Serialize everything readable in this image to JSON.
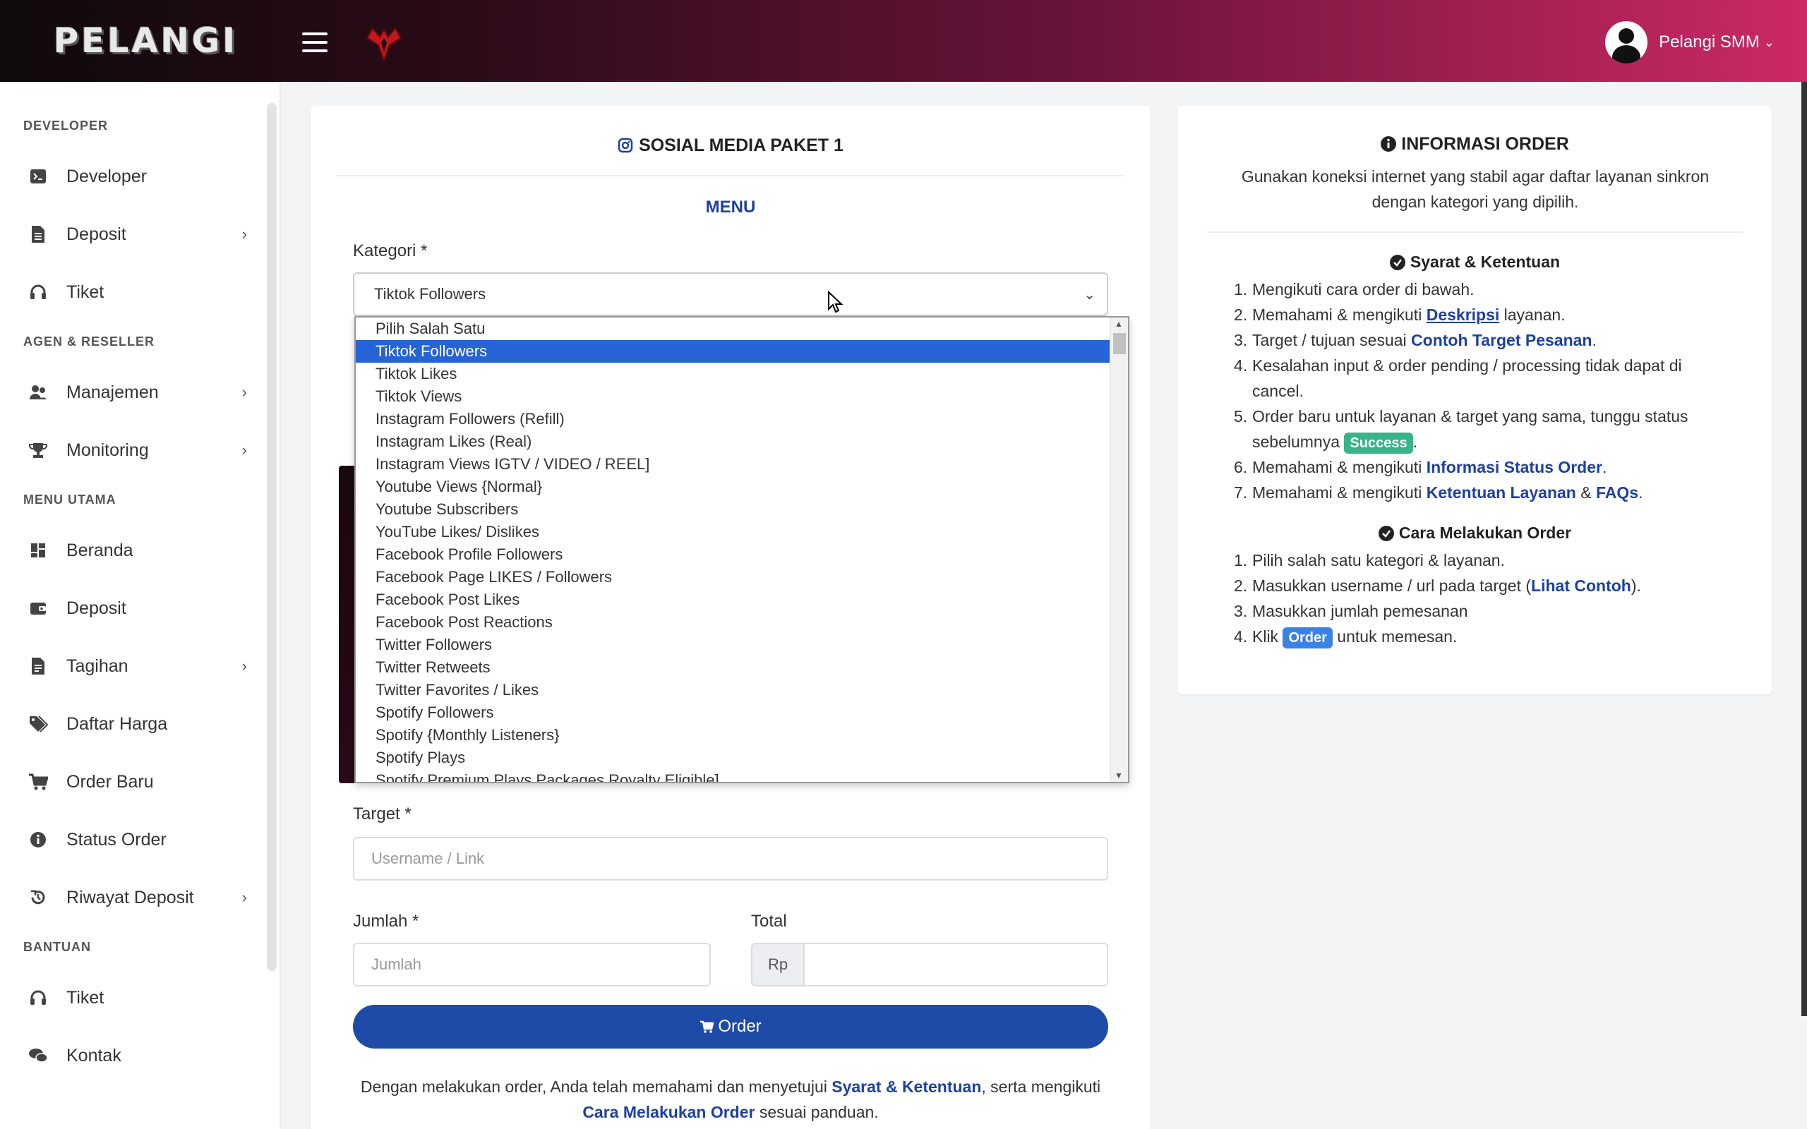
{
  "header": {
    "brand": "PELANGI",
    "user_name": "Pelangi SMM"
  },
  "sidebar": {
    "sections": [
      {
        "label": "DEVELOPER"
      },
      {
        "label": "AGEN & RESELLER"
      },
      {
        "label": "MENU UTAMA"
      },
      {
        "label": "BANTUAN"
      }
    ],
    "items": [
      {
        "label": "Developer",
        "icon": "terminal-icon"
      },
      {
        "label": "Deposit",
        "icon": "document-icon"
      },
      {
        "label": "Tiket",
        "icon": "headset-icon"
      },
      {
        "label": "Manajemen",
        "icon": "users-icon"
      },
      {
        "label": "Monitoring",
        "icon": "trophy-icon"
      },
      {
        "label": "Beranda",
        "icon": "dashboard-icon"
      },
      {
        "label": "Deposit",
        "icon": "wallet-icon"
      },
      {
        "label": "Tagihan",
        "icon": "invoice-icon"
      },
      {
        "label": "Daftar Harga",
        "icon": "tags-icon"
      },
      {
        "label": "Order Baru",
        "icon": "cart-icon"
      },
      {
        "label": "Status Order",
        "icon": "info-icon"
      },
      {
        "label": "Riwayat Deposit",
        "icon": "history-icon"
      },
      {
        "label": "Tiket",
        "icon": "headset-icon"
      },
      {
        "label": "Kontak",
        "icon": "chat-icon"
      }
    ]
  },
  "order_form": {
    "title": "SOSIAL MEDIA PAKET 1",
    "menu_label": "MENU",
    "kategori_label": "Kategori *",
    "kategori_value": "Tiktok Followers",
    "kategori_options": [
      "Pilih Salah Satu",
      "Tiktok Followers",
      "Tiktok Likes",
      "Tiktok Views",
      "Instagram Followers (Refill)",
      "Instagram Likes (Real)",
      "Instagram Views IGTV / VIDEO / REEL]",
      "Youtube Views {Normal}",
      "Youtube Subscribers",
      "YouTube Likes/ Dislikes",
      "Facebook Profile Followers",
      "Facebook Page LIKES / Followers",
      "Facebook Post Likes",
      "Facebook Post Reactions",
      "Twitter Followers",
      "Twitter Retweets",
      "Twitter Favorites / Likes",
      "Spotify Followers",
      "Spotify {Monthly Listeners}",
      "Spotify Plays",
      "Spotify Premium Plays Packages Royalty Eligible]"
    ],
    "target_label": "Target *",
    "target_placeholder": "Username / Link",
    "jumlah_label": "Jumlah *",
    "jumlah_placeholder": "Jumlah",
    "total_label": "Total",
    "currency": "Rp",
    "order_button": "Order",
    "note_prefix": "Dengan melakukan order, Anda telah memahami dan menyetujui ",
    "note_link1": "Syarat & Ketentuan",
    "note_mid": ", serta mengikuti ",
    "note_link2": "Cara Melakukan Order",
    "note_suffix": " sesuai panduan."
  },
  "info": {
    "title": "INFORMASI ORDER",
    "subtitle": "Gunakan koneksi internet yang stabil agar daftar layanan sinkron dengan kategori yang dipilih.",
    "terms_title": "Syarat & Ketentuan",
    "terms": {
      "t1": "Mengikuti cara order di bawah.",
      "t2_a": "Memahami & mengikuti ",
      "t2_link": "Deskripsi",
      "t2_b": " layanan.",
      "t3_a": "Target / tujuan sesuai ",
      "t3_link": "Contoh Target Pesanan",
      "t3_b": ".",
      "t4": "Kesalahan input & order pending / processing tidak dapat di cancel.",
      "t5_a": "Order baru untuk layanan & target yang sama, tunggu status sebelumnya ",
      "t5_badge": "Success",
      "t5_b": ".",
      "t6_a": "Memahami & mengikuti ",
      "t6_link": "Informasi Status Order",
      "t6_b": ".",
      "t7_a": "Memahami & mengikuti ",
      "t7_link1": "Ketentuan Layanan",
      "t7_mid": " & ",
      "t7_link2": "FAQs",
      "t7_b": "."
    },
    "howto_title": "Cara Melakukan Order",
    "howto": {
      "h1": "Pilih salah satu kategori & layanan.",
      "h2_a": "Masukkan username / url pada target (",
      "h2_link": "Lihat Contoh",
      "h2_b": ").",
      "h3": "Masukkan jumlah pemesanan",
      "h4_a": "Klik ",
      "h4_badge": "Order",
      "h4_b": " untuk memesan."
    }
  }
}
